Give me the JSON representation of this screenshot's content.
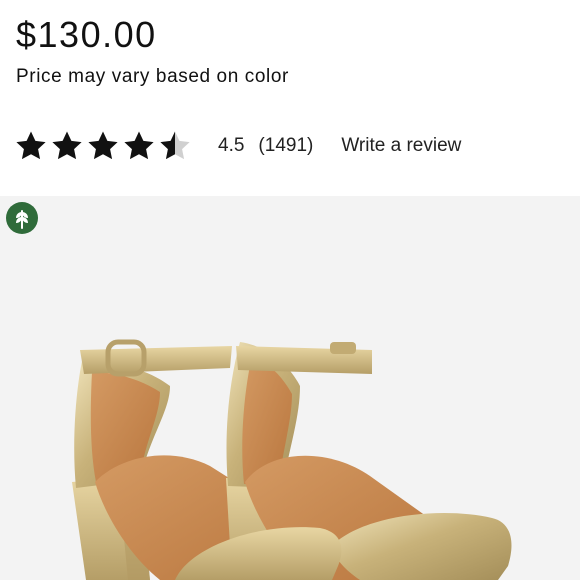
{
  "product": {
    "price": "$130.00",
    "price_note": "Price may vary based on color"
  },
  "rating": {
    "value": 4.5,
    "value_label": "4.5",
    "count_label": "(1491)",
    "write_review_label": "Write a review",
    "stars": [
      "full",
      "full",
      "full",
      "full",
      "half"
    ]
  },
  "image": {
    "badge_icon": "leaf-icon",
    "subject": "product-photo-sandals"
  },
  "colors": {
    "badge": "#2f6b3a",
    "image_bg": "#f3f3f3",
    "star": "#111111",
    "star_empty": "#d0d0d0"
  }
}
